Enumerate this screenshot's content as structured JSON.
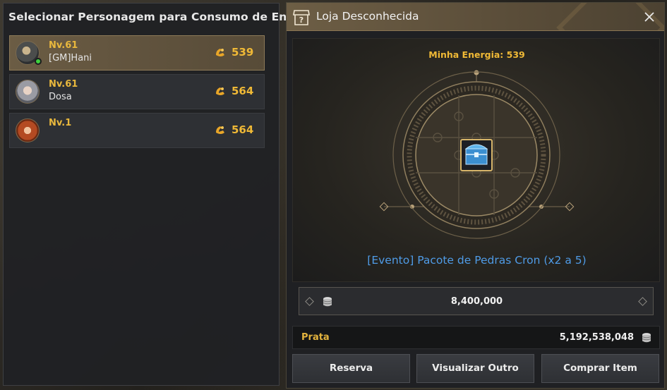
{
  "left_panel": {
    "title": "Selecionar Personagem para Consumo de Energia",
    "characters": [
      {
        "level": "Nv.61",
        "name": "[GM]Hani",
        "energy": "539",
        "selected": true,
        "online": true
      },
      {
        "level": "Nv.61",
        "name": "Dosa",
        "energy": "564",
        "selected": false,
        "online": false
      },
      {
        "level": "Nv.1",
        "name": "",
        "energy": "564",
        "selected": false,
        "online": false
      }
    ]
  },
  "shop": {
    "title": "Loja Desconhecida",
    "my_energy": "Minha Energia: 539",
    "item_name": "[Evento] Pacote de Pedras Cron (x2 a 5)",
    "price": "8,400,000",
    "currency_label": "Prata",
    "currency_value": "5,192,538,048",
    "buttons": {
      "reserve": "Reserva",
      "view_other": "Visualizar Outro",
      "buy": "Comprar Item"
    }
  },
  "icons": {
    "shop": "shop-icon",
    "close": "close-icon",
    "energy": "energy-icon",
    "coin": "silver-coin-icon",
    "item": "treasure-chest-icon"
  },
  "colors": {
    "accent_gold": "#f0b936",
    "item_blue": "#4f9be6",
    "selected_row": "#6b5c44",
    "header": "#6d5e45"
  }
}
